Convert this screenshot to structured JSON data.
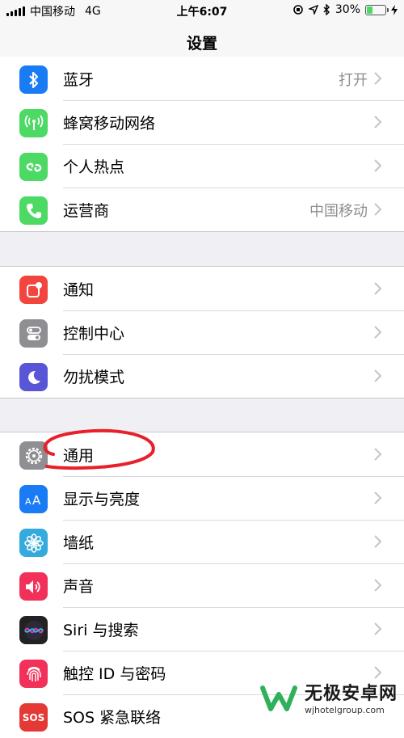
{
  "status_bar": {
    "carrier": "中国移动",
    "network": "4G",
    "time": "上午6:07",
    "battery_percent": "30%",
    "battery_level": 0.3
  },
  "nav": {
    "title": "设置"
  },
  "groups": [
    [
      {
        "label": "蓝牙",
        "value": "打开",
        "icon": "bluetooth-icon",
        "color": "#1a7cf5"
      },
      {
        "label": "蜂窝移动网络",
        "value": "",
        "icon": "cellular-icon",
        "color": "#4cd964"
      },
      {
        "label": "个人热点",
        "value": "",
        "icon": "hotspot-icon",
        "color": "#4cd964"
      },
      {
        "label": "运营商",
        "value": "中国移动",
        "icon": "phone-icon",
        "color": "#4cd964"
      }
    ],
    [
      {
        "label": "通知",
        "value": "",
        "icon": "notifications-icon",
        "color": "#f2453d"
      },
      {
        "label": "控制中心",
        "value": "",
        "icon": "control-center-icon",
        "color": "#8e8e93"
      },
      {
        "label": "勿扰模式",
        "value": "",
        "icon": "moon-icon",
        "color": "#5856d6"
      }
    ],
    [
      {
        "label": "通用",
        "value": "",
        "icon": "gear-icon",
        "color": "#8e8e93"
      },
      {
        "label": "显示与亮度",
        "value": "",
        "icon": "display-icon",
        "color": "#1a7cf5"
      },
      {
        "label": "墙纸",
        "value": "",
        "icon": "wallpaper-icon",
        "color": "#35aadc"
      },
      {
        "label": "声音",
        "value": "",
        "icon": "sound-icon",
        "color": "#f2315a"
      },
      {
        "label": "Siri 与搜索",
        "value": "",
        "icon": "siri-icon",
        "color": "#222"
      },
      {
        "label": "触控 ID 与密码",
        "value": "",
        "icon": "fingerprint-icon",
        "color": "#f2315a"
      },
      {
        "label": "SOS 紧急联络",
        "value": "",
        "icon": "sos-icon",
        "color": "#e53935"
      }
    ]
  ],
  "watermark": {
    "title": "无极安卓网",
    "url": "wjhotelgroup.com"
  },
  "colors": {
    "background": "#efeff4",
    "annotation": "#e8202a"
  }
}
